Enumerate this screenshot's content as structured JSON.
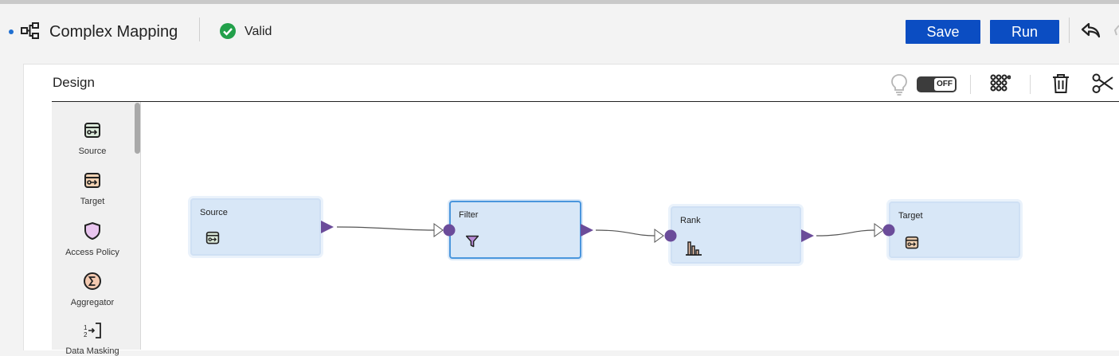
{
  "header": {
    "title": "Complex Mapping",
    "status": "Valid",
    "save_label": "Save",
    "run_label": "Run"
  },
  "design": {
    "label": "Design",
    "toggle_label": "OFF"
  },
  "palette": {
    "items": [
      {
        "label": "Source",
        "icon": "source-icon"
      },
      {
        "label": "Target",
        "icon": "target-icon"
      },
      {
        "label": "Access Policy",
        "icon": "shield-icon"
      },
      {
        "label": "Aggregator",
        "icon": "sigma-icon"
      },
      {
        "label": "Data Masking",
        "icon": "data-masking-icon"
      }
    ]
  },
  "canvas": {
    "nodes": [
      {
        "label": "Source",
        "icon": "source-icon"
      },
      {
        "label": "Filter",
        "icon": "funnel-icon",
        "selected": true
      },
      {
        "label": "Rank",
        "icon": "rank-icon"
      },
      {
        "label": "Target",
        "icon": "target-icon"
      }
    ]
  },
  "colors": {
    "accent": "#0b4dc2",
    "valid": "#22a04a",
    "port": "#6b4c9a",
    "node_fill": "#d8e7f7",
    "node_selected_border": "#4a96dd"
  }
}
